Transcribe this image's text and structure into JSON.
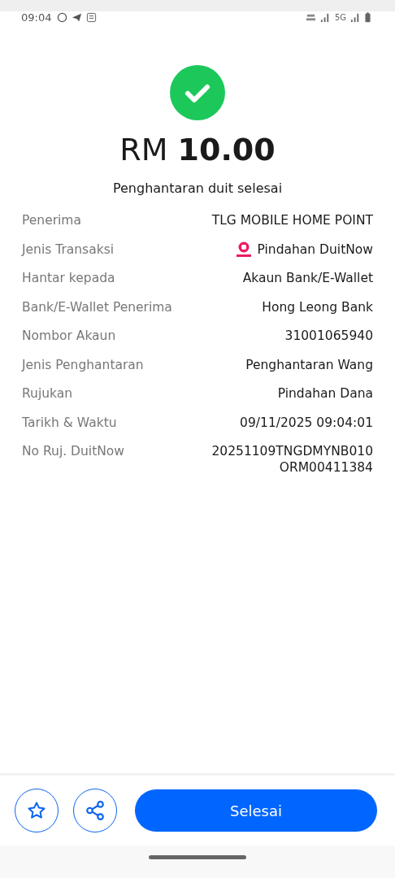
{
  "status_bar": {
    "time": "09:04",
    "network": "5G"
  },
  "amount": "RM **10.00**",
  "message": "Penghantaran duit selesai",
  "details": [
    {
      "label": "Penerima",
      "value": "TLG MOBILE HOME POINT",
      "kind": "text"
    },
    {
      "label": "Jenis Transaksi",
      "value": "Pindahan DuitNow",
      "kind": "duitnow"
    },
    {
      "label": "Hantar kepada",
      "value": "Akaun Bank/E-Wallet",
      "kind": "text"
    },
    {
      "label": "Bank/E-Wallet Penerima",
      "value": "Hong Leong Bank",
      "kind": "text"
    },
    {
      "label": "Nombor Akaun",
      "value": "31001065940",
      "kind": "text"
    },
    {
      "label": "Jenis Penghantaran",
      "value": "Penghantaran Wang",
      "kind": "text"
    },
    {
      "label": "Rujukan",
      "value": "Pindahan Dana",
      "kind": "text"
    },
    {
      "label": "Tarikh & Waktu",
      "value": "09/11/2025 09:04:01",
      "kind": "text"
    },
    {
      "label": "No Ruj. DuitNow",
      "value": "20251109TNGDMYNB010\nORM00411384",
      "kind": "text"
    }
  ],
  "done_button": "Selesai"
}
